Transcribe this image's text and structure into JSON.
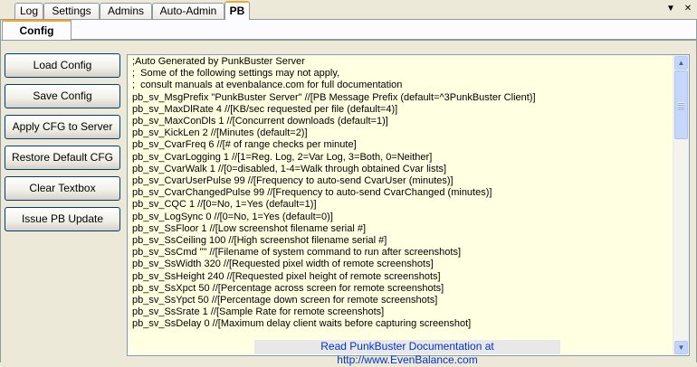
{
  "tabs": [
    {
      "label": "Log"
    },
    {
      "label": "Settings"
    },
    {
      "label": "Admins"
    },
    {
      "label": "Auto-Admin"
    },
    {
      "label": "PB"
    }
  ],
  "top_icons": {
    "dropdown": "▼",
    "close": "✕"
  },
  "subtab": {
    "label": "Config"
  },
  "buttons": {
    "load": "Load Config",
    "save": "Save Config",
    "apply": "Apply CFG to Server",
    "restore": "Restore Default CFG",
    "clear": "Clear Textbox",
    "issue": "Issue PB Update"
  },
  "config_lines": [
    ";Auto Generated by PunkBuster Server",
    ";  Some of the following settings may not apply,",
    ";  consult manuals at evenbalance.com for full documentation",
    "pb_sv_MsgPrefix \"PunkBuster Server\" //[PB Message Prefix (default=^3PunkBuster Client)]",
    "pb_sv_MaxDlRate 4 //[KB/sec requested per file (default=4)]",
    "pb_sv_MaxConDls 1 //[Concurrent downloads (default=1)]",
    "pb_sv_KickLen 2 //[Minutes (default=2)]",
    "pb_sv_CvarFreq 6 //[# of range checks per minute]",
    "pb_sv_CvarLogging 1 //[1=Reg. Log, 2=Var Log, 3=Both, 0=Neither]",
    "pb_sv_CvarWalk 1 //[0=disabled, 1-4=Walk through obtained Cvar lists]",
    "pb_sv_CvarUserPulse 99 //[Frequency to auto-send CvarUser (minutes)]",
    "pb_sv_CvarChangedPulse 99 //[Frequency to auto-send CvarChanged (minutes)]",
    "pb_sv_CQC 1 //[0=No, 1=Yes (default=1)]",
    "pb_sv_LogSync 0 //[0=No, 1=Yes (default=0)]",
    "pb_sv_SsFloor 1 //[Low screenshot filename serial #]",
    "pb_sv_SsCeiling 100 //[High screenshot filename serial #]",
    "pb_sv_SsCmd \"\" //[Filename of system command to run after screenshots]",
    "pb_sv_SsWidth 320 //[Requested pixel width of remote screenshots]",
    "pb_sv_SsHeight 240 //[Requested pixel height of remote screenshots]",
    "pb_sv_SsXpct 50 //[Percentage across screen for remote screenshots]",
    "pb_sv_SsYpct 50 //[Percentage down screen for remote screenshots]",
    "pb_sv_SsSrate 1 //[Sample Rate for remote screenshots]",
    "pb_sv_SsDelay 0 //[Maximum delay client waits before capturing screenshot]"
  ],
  "scrollbar": {
    "up_arrow": "▲",
    "down_arrow": "▼"
  },
  "doc_link": "Read PunkBuster Documentation at http://www.EvenBalance.com"
}
